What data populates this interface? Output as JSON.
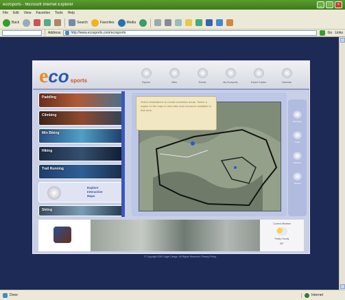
{
  "window": {
    "title": "ecoSports - Microsoft Internet Explorer"
  },
  "menu": [
    "File",
    "Edit",
    "View",
    "Favorites",
    "Tools",
    "Help"
  ],
  "toolbar": {
    "back": "Back",
    "search": "Search",
    "favorites": "Favorites",
    "media": "Media"
  },
  "address": {
    "label": "Address",
    "url": "http://www.ecosports.com/ecosports",
    "go": "Go",
    "links": "Links"
  },
  "site": {
    "logo_e": "e",
    "logo_co": "co",
    "logo_sports": "sports",
    "nav": [
      "Explore",
      "Sites",
      "Events",
      "My Ecosports",
      "Expert Guides",
      "Calendar"
    ],
    "sidebar": [
      {
        "label": "Paddling"
      },
      {
        "label": "Climbing"
      },
      {
        "label": "Mtn Biking"
      },
      {
        "label": "Hiking"
      },
      {
        "label": "Trail Running"
      },
      {
        "label": "Explore\nInteractive\nMaps"
      },
      {
        "label": "Skiing"
      }
    ],
    "tooltip": "Select destinations to reveal recreation areas. Select a region on the map to view sites and resources available in that area.",
    "right_tools": [
      "Find Sites",
      "Trails",
      "Weather",
      "Routes"
    ],
    "weather": {
      "title": "Current Weather",
      "condition": "Partly Cloudy",
      "temp": "65°"
    },
    "footer": "© Copyright 2002 Eagle Design. All Rights Reserved. Privacy Policy"
  },
  "status": {
    "left": "Done",
    "zone": "Internet"
  }
}
